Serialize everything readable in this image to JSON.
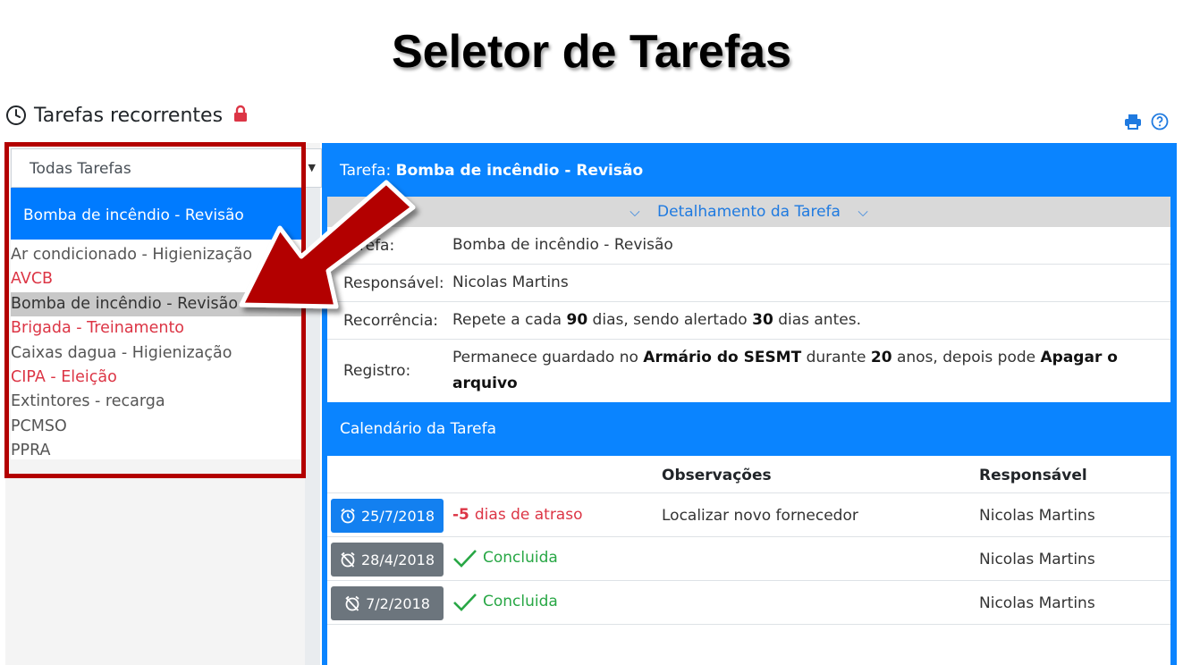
{
  "slide_title": "Seletor de Tarefas",
  "header": {
    "title": "Tarefas recorrentes",
    "icons": [
      "clock-icon",
      "lock-icon",
      "print-icon",
      "help-icon"
    ]
  },
  "selector": {
    "value": "Todas Tarefas",
    "selected": "Bomba de incêndio - Revisão",
    "items": [
      {
        "label": "Ar condicionado - Higienização",
        "status": "normal"
      },
      {
        "label": "AVCB",
        "status": "overdue"
      },
      {
        "label": "Bomba de incêndio - Revisão",
        "status": "highlighted"
      },
      {
        "label": "Brigada - Treinamento",
        "status": "overdue"
      },
      {
        "label": "Caixas dagua - Higienização",
        "status": "normal"
      },
      {
        "label": "CIPA - Eleição",
        "status": "overdue"
      },
      {
        "label": "Extintores - recarga",
        "status": "normal"
      },
      {
        "label": "PCMSO",
        "status": "normal"
      },
      {
        "label": "PPRA",
        "status": "normal"
      }
    ]
  },
  "task": {
    "header_label": "Tarefa:",
    "header_name": "Bomba de incêndio - Revisão",
    "detail_toggle": "Detalhamento da Tarefa",
    "rows": {
      "task_label": "Tarefa:",
      "task_value": "Bomba de incêndio - Revisão",
      "responsible_label": "Responsável:",
      "responsible_value": "Nicolas Martins",
      "recurrence_label": "Recorrência:",
      "recurrence_p1": "Repete a cada ",
      "recurrence_days": "90",
      "recurrence_p2": " dias, sendo alertado ",
      "recurrence_alert": "30",
      "recurrence_p3": " dias antes.",
      "registry_label": "Registro:",
      "registry_p1": "Permanece guardado no ",
      "registry_place": "Armário do SESMT",
      "registry_p2": " durante ",
      "registry_years": "20",
      "registry_p3": " anos, depois pode ",
      "registry_action": "Apagar o arquivo"
    }
  },
  "calendar": {
    "title": "Calendário da Tarefa",
    "columns": {
      "observations": "Observações",
      "responsible": "Responsável"
    },
    "entries": [
      {
        "date": "25/7/2018",
        "status_num": "-5",
        "status_text": " dias de atraso",
        "observation": "Localizar novo fornecedor",
        "responsible": "Nicolas Martins"
      },
      {
        "date": "28/4/2018",
        "status_text": "Concluida",
        "observation": "",
        "responsible": "Nicolas Martins"
      },
      {
        "date": "7/2/2018",
        "status_text": "Concluida",
        "observation": "",
        "responsible": "Nicolas Martins"
      }
    ]
  },
  "colors": {
    "primary": "#0a84ff",
    "overdue": "#dc3545",
    "done": "#28a745",
    "annotation_arrow": "#b30000"
  }
}
